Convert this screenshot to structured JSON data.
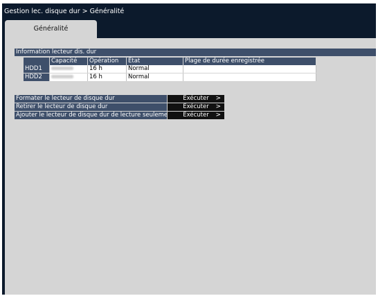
{
  "window": {
    "title": "Gestion lec. disque dur > Généralité"
  },
  "tabs": [
    {
      "label": "Généralité",
      "active": true
    }
  ],
  "hdd_info": {
    "section_title": "Information lecteur dis. dur",
    "columns": [
      "",
      "Capacité",
      "Opération",
      "État",
      "Plage de durée enregistrée"
    ],
    "rows": [
      {
        "name": "HDD1",
        "capacity": "",
        "operation": "16 h",
        "state": "Normal",
        "range": ""
      },
      {
        "name": "HDD2",
        "capacity": "",
        "operation": "16 h",
        "state": "Normal",
        "range": ""
      }
    ]
  },
  "actions": [
    {
      "label": "Formater le lecteur de disque dur",
      "button": "Exécuter",
      "arrow": ">"
    },
    {
      "label": "Retirer le lecteur de disque dur",
      "button": "Exécuter",
      "arrow": ">"
    },
    {
      "label": "Ajouter le lecteur de disque dur de lecture seulement",
      "button": "Exécuter",
      "arrow": ">"
    }
  ],
  "colors": {
    "window_bg": "#0c1a2c",
    "panel_bg": "#d5d5d5",
    "header_bg": "#3e4f6a",
    "button_bg": "#111111"
  }
}
